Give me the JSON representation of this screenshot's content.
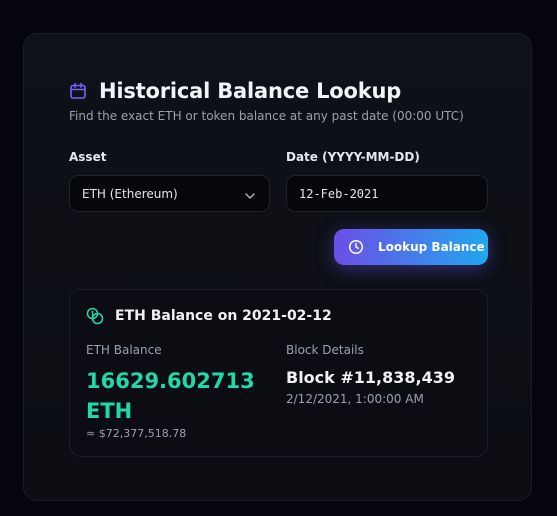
{
  "header": {
    "title": "Historical Balance Lookup",
    "subtitle": "Find the exact ETH or token balance at any past date (00:00 UTC)",
    "icon": "calendar-icon"
  },
  "form": {
    "asset_label": "Asset",
    "asset_value": "ETH (Ethereum)",
    "date_label": "Date (YYYY-MM-DD)",
    "date_value": "12-Feb-2021",
    "lookup_button_label": "Lookup Balance"
  },
  "result": {
    "title": "ETH Balance on 2021-02-12",
    "balance_label": "ETH Balance",
    "balance_value": "16629.602713 ETH",
    "usd_value": "≈ $72,377,518.78",
    "block_label": "Block Details",
    "block_number": "Block #11,838,439",
    "block_time": "2/12/2021, 1:00:00 AM"
  },
  "colors": {
    "background": "#05060d",
    "card": "#0f1118",
    "accent_purple": "#7b61ff",
    "accent_blue": "#22a6ef",
    "balance_green": "#20d9a6"
  }
}
